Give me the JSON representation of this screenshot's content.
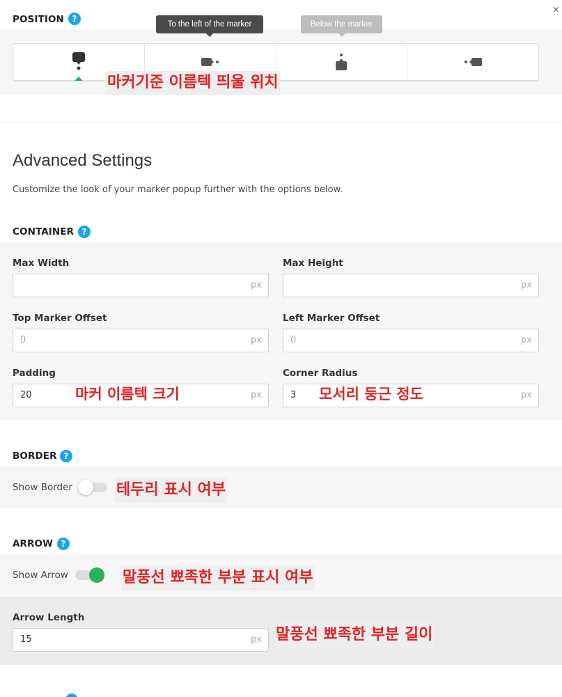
{
  "window": {
    "close_glyph": "×"
  },
  "position": {
    "heading": "POSITION",
    "help_glyph": "?",
    "tabs": [
      {
        "name": "above-marker",
        "active": true
      },
      {
        "name": "left-of-marker",
        "active": false
      },
      {
        "name": "below-marker",
        "active": false
      },
      {
        "name": "right-of-marker",
        "active": false
      }
    ],
    "tooltips": {
      "left": "To the left of the marker",
      "below": "Below the marker"
    },
    "annotation": "마커기준 이름텍 띄울 위치"
  },
  "advanced": {
    "title": "Advanced Settings",
    "description": "Customize the look of your marker popup further with the options below."
  },
  "container": {
    "heading": "CONTAINER",
    "help_glyph": "?",
    "fields": {
      "max_width": {
        "label": "Max Width",
        "value": "",
        "placeholder": "",
        "unit": "px"
      },
      "max_height": {
        "label": "Max Height",
        "value": "",
        "placeholder": "",
        "unit": "px"
      },
      "top_offset": {
        "label": "Top Marker Offset",
        "value": "",
        "placeholder": "0",
        "unit": "px"
      },
      "left_offset": {
        "label": "Left Marker Offset",
        "value": "",
        "placeholder": "0",
        "unit": "px"
      },
      "padding": {
        "label": "Padding",
        "value": "20",
        "unit": "px"
      },
      "corner_radius": {
        "label": "Corner Radius",
        "value": "3",
        "unit": "px"
      }
    },
    "annotations": {
      "padding": "마커 이름텍 크기",
      "corner_radius": "모서리 둥근 정도"
    }
  },
  "border": {
    "heading": "BORDER",
    "help_glyph": "?",
    "toggle_label": "Show Border",
    "toggle_on": false,
    "annotation": "테두리 표시 여부"
  },
  "arrow": {
    "heading": "ARROW",
    "help_glyph": "?",
    "toggle_label": "Show Arrow",
    "toggle_on": true,
    "annotation": "말풍선 뾰족한 부분 표시 여부",
    "length": {
      "label": "Arrow Length",
      "value": "15",
      "unit": "px"
    },
    "length_annotation": "말풍선 뾰족한 부분 길이"
  },
  "colors": {
    "accent_green": "#27b35a",
    "help_blue": "#1aa5e6",
    "annotation_red": "#e02424"
  }
}
